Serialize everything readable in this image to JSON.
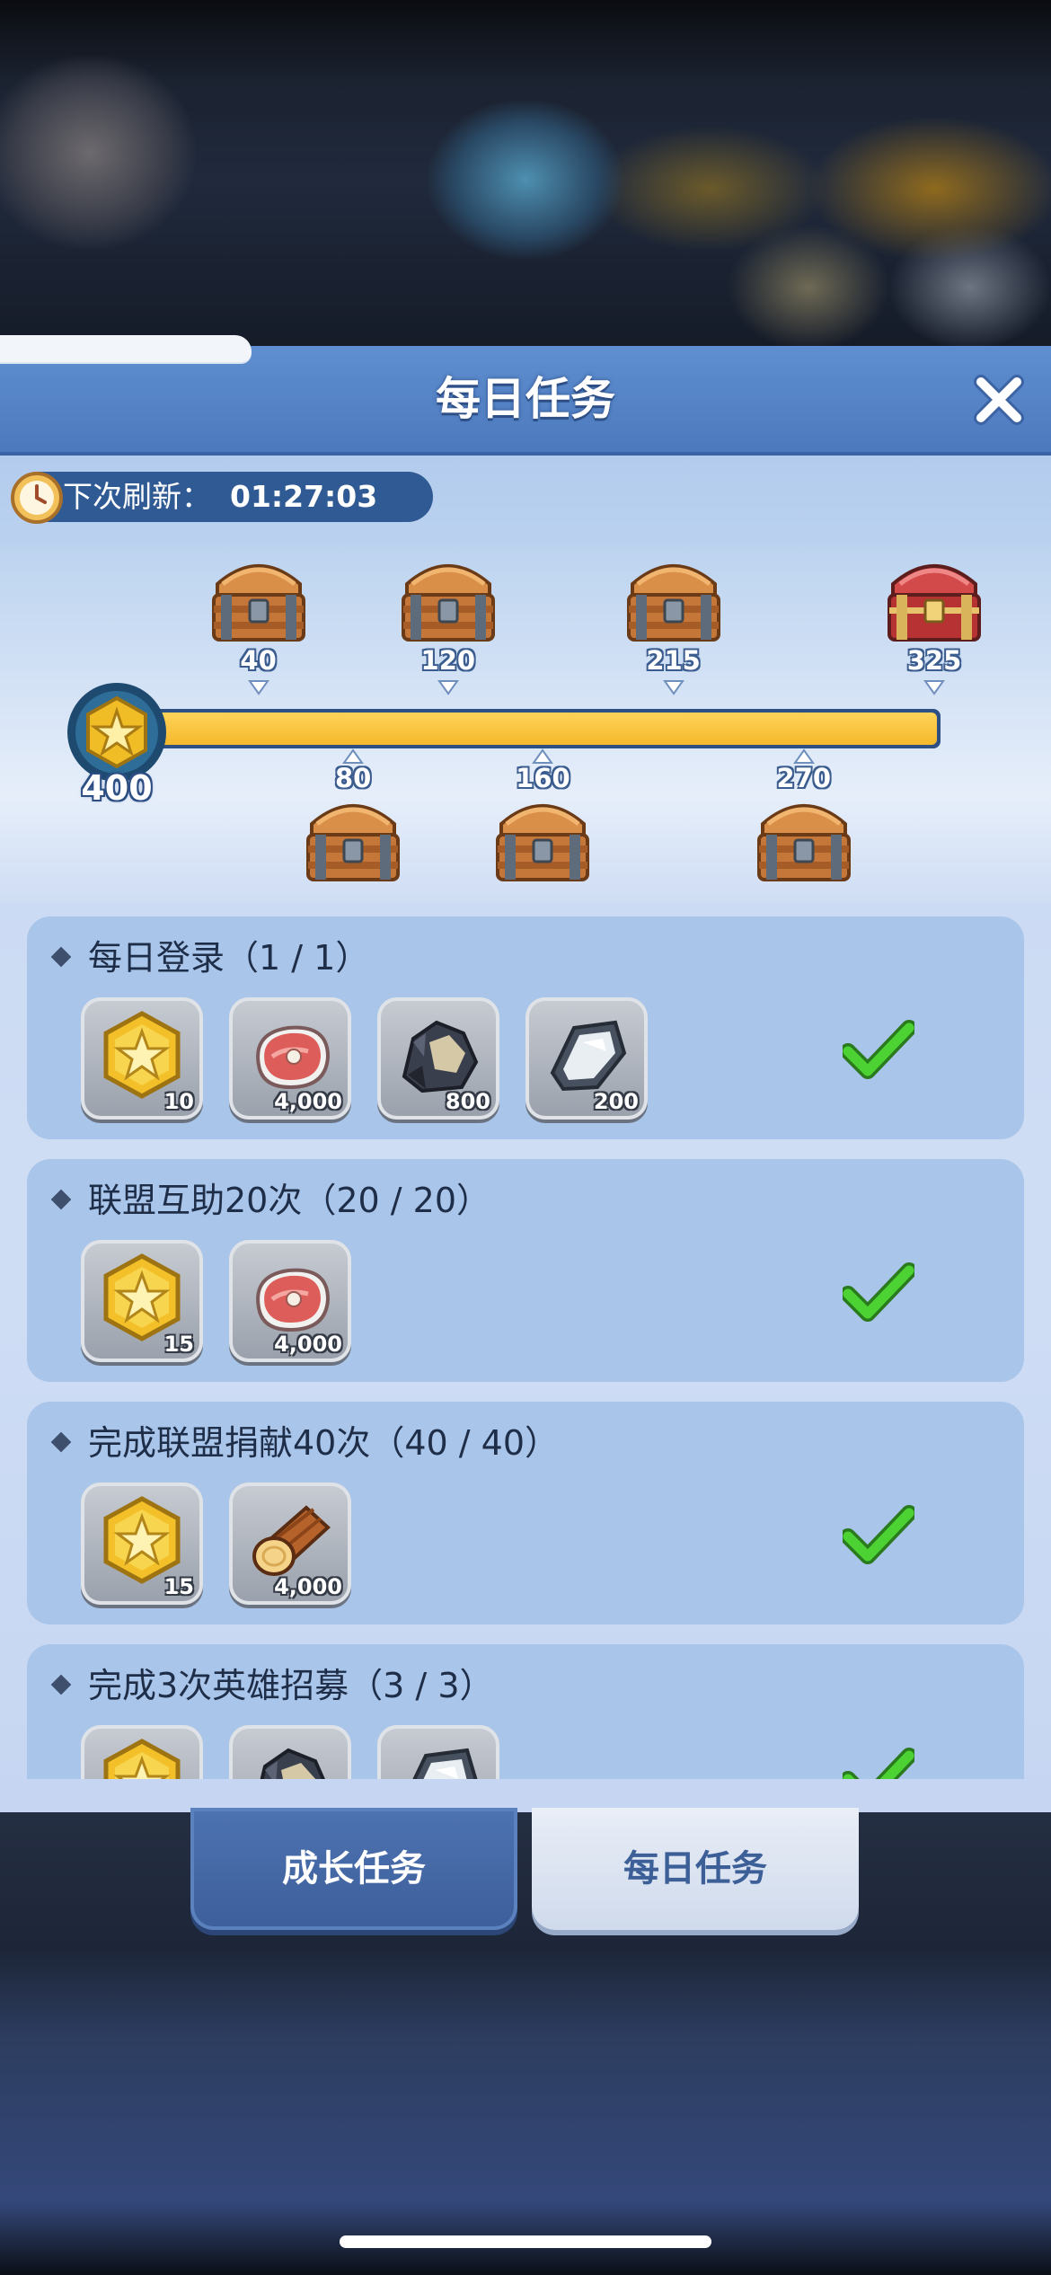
{
  "panel": {
    "title": "每日任务",
    "refresh_label": "下次刷新：",
    "refresh_time": "01:27:03"
  },
  "progress": {
    "total_points": "400",
    "max_points": 325,
    "fill_fraction": 1.0,
    "milestones_top": [
      {
        "value": "40",
        "chest": "wooden-chest"
      },
      {
        "value": "120",
        "chest": "wooden-chest"
      },
      {
        "value": "215",
        "chest": "wooden-chest"
      },
      {
        "value": "325",
        "chest": "red-chest"
      }
    ],
    "milestones_bottom": [
      {
        "value": "80",
        "chest": "wooden-chest"
      },
      {
        "value": "160",
        "chest": "wooden-chest"
      },
      {
        "value": "270",
        "chest": "wooden-chest"
      }
    ]
  },
  "tasks": [
    {
      "title": "每日登录（1 / 1）",
      "completed": true,
      "rewards": [
        {
          "icon": "gold-star-medal-icon",
          "qty": "10"
        },
        {
          "icon": "meat-icon",
          "qty": "4,000"
        },
        {
          "icon": "coal-ore-icon",
          "qty": "800"
        },
        {
          "icon": "iron-ore-icon",
          "qty": "200"
        }
      ]
    },
    {
      "title": "联盟互助20次（20 / 20）",
      "completed": true,
      "rewards": [
        {
          "icon": "gold-star-medal-icon",
          "qty": "15"
        },
        {
          "icon": "meat-icon",
          "qty": "4,000"
        }
      ]
    },
    {
      "title": "完成联盟捐献40次（40 / 40）",
      "completed": true,
      "rewards": [
        {
          "icon": "gold-star-medal-icon",
          "qty": "15"
        },
        {
          "icon": "wood-log-icon",
          "qty": "4,000"
        }
      ]
    },
    {
      "title": "完成3次英雄招募（3 / 3）",
      "completed": true,
      "rewards": [
        {
          "icon": "gold-star-medal-icon",
          "qty": ""
        },
        {
          "icon": "coal-ore-icon",
          "qty": ""
        },
        {
          "icon": "iron-ore-icon",
          "qty": ""
        }
      ]
    }
  ],
  "tabs": {
    "growth": "成长任务",
    "daily": "每日任务",
    "active": "daily"
  },
  "colors": {
    "header": "#4c79bd",
    "progress_fill": "#f5b92b",
    "check": "#3fbf2a"
  }
}
